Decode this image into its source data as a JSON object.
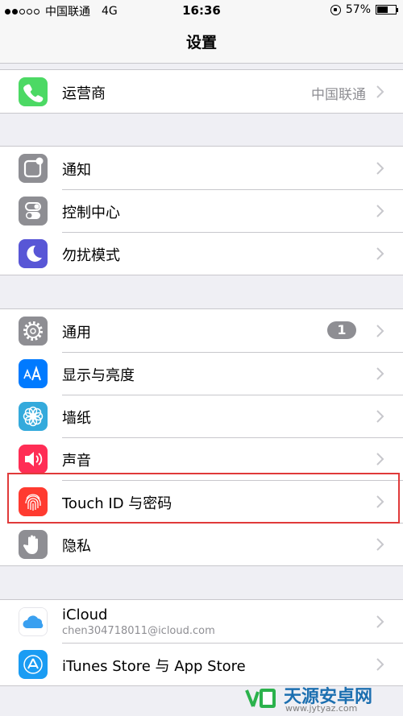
{
  "status_bar": {
    "carrier": "中国联通",
    "network": "4G",
    "time": "16:36",
    "battery": "57%",
    "battery_level": 0.57,
    "signal_filled": 2,
    "signal_total": 5
  },
  "nav": {
    "title": "设置"
  },
  "groups": [
    {
      "rows": [
        {
          "label": "运营商",
          "detail": "中国联通",
          "icon": "phone-icon",
          "color": "#4cd964"
        }
      ]
    },
    {
      "rows": [
        {
          "label": "通知",
          "icon": "notifications-icon",
          "color": "#8e8e93"
        },
        {
          "label": "控制中心",
          "icon": "control-center-icon",
          "color": "#8e8e93"
        },
        {
          "label": "勿扰模式",
          "icon": "moon-icon",
          "color": "#5856d6"
        }
      ]
    },
    {
      "rows": [
        {
          "label": "通用",
          "badge": "1",
          "icon": "gear-icon",
          "color": "#8e8e93"
        },
        {
          "label": "显示与亮度",
          "icon": "text-size-icon",
          "color": "#007aff"
        },
        {
          "label": "墙纸",
          "icon": "flower-icon",
          "color": "#34aadc"
        },
        {
          "label": "声音",
          "icon": "speaker-icon",
          "color": "#ff2d55"
        },
        {
          "label": "Touch ID 与密码",
          "icon": "fingerprint-icon",
          "color": "#ff3b30"
        },
        {
          "label": "隐私",
          "icon": "hand-icon",
          "color": "#8e8e93"
        }
      ]
    },
    {
      "rows": [
        {
          "label": "iCloud",
          "sublabel": "chen304718011@icloud.com",
          "icon": "cloud-icon",
          "color": "#ffffff"
        },
        {
          "label": "iTunes Store 与 App Store",
          "icon": "app-store-icon",
          "color": "#1a9cf3"
        }
      ]
    }
  ],
  "watermark": {
    "name": "天源安卓网",
    "url": "www.jytyaz.com"
  }
}
